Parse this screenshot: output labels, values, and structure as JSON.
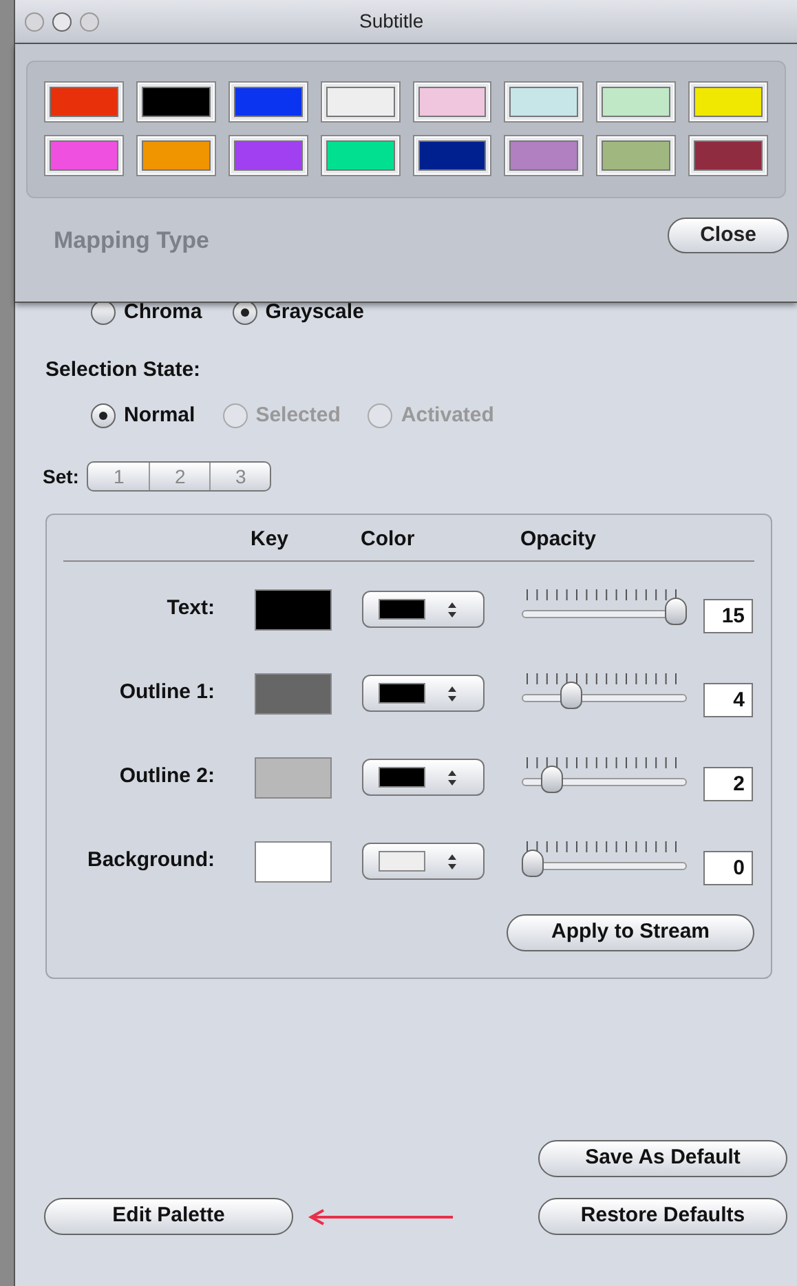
{
  "window": {
    "title": "Subtitle"
  },
  "palette": {
    "swatches": [
      {
        "color": "#e8300a"
      },
      {
        "color": "#000000"
      },
      {
        "color": "#0a34f0"
      },
      {
        "color": "#eeeeee"
      },
      {
        "color": "#f0c6de"
      },
      {
        "color": "#c6e6e8"
      },
      {
        "color": "#c0e8c6"
      },
      {
        "color": "#f0e800"
      },
      {
        "color": "#f050e0"
      },
      {
        "color": "#f09400"
      },
      {
        "color": "#a040f0"
      },
      {
        "color": "#00e090"
      },
      {
        "color": "#002090"
      },
      {
        "color": "#b080c0"
      },
      {
        "color": "#a0b880"
      },
      {
        "color": "#902c40"
      }
    ],
    "close_button": "Close"
  },
  "mapping_type": {
    "label": "Mapping Type",
    "options": [
      {
        "label": "Chroma",
        "selected": false
      },
      {
        "label": "Grayscale",
        "selected": true
      }
    ]
  },
  "selection_state": {
    "label": "Selection State:",
    "options": [
      {
        "label": "Normal",
        "selected": true,
        "disabled": false
      },
      {
        "label": "Selected",
        "selected": false,
        "disabled": true
      },
      {
        "label": "Activated",
        "selected": false,
        "disabled": true
      }
    ]
  },
  "set": {
    "label": "Set:",
    "segments": [
      {
        "label": "1",
        "selected": false
      },
      {
        "label": "2",
        "selected": false
      },
      {
        "label": "3",
        "selected": false
      }
    ]
  },
  "table": {
    "columns": [
      "Key",
      "Color",
      "Opacity"
    ],
    "rows": [
      {
        "label": "Text:",
        "color": "#000000",
        "popup": {
          "color": "#000000"
        },
        "level": 1,
        "value": "15"
      },
      {
        "label": "Outline 1:",
        "color": "#666666",
        "popup": {
          "color": "#000000"
        },
        "level": 0.27,
        "value": "4"
      },
      {
        "label": "Outline 2:",
        "color": "#b8b8b8",
        "popup": {
          "color": "#000000"
        },
        "level": 0.13,
        "value": "2"
      },
      {
        "label": "Background:",
        "color": "#ffffff",
        "popup": {
          "color": "#eeeeee"
        },
        "level": 0,
        "value": "0"
      }
    ],
    "apply_button": "Apply to Stream"
  },
  "buttons": {
    "save_default": "Save As Default",
    "edit_palette": "Edit Palette",
    "restore_defaults": "Restore Defaults"
  }
}
